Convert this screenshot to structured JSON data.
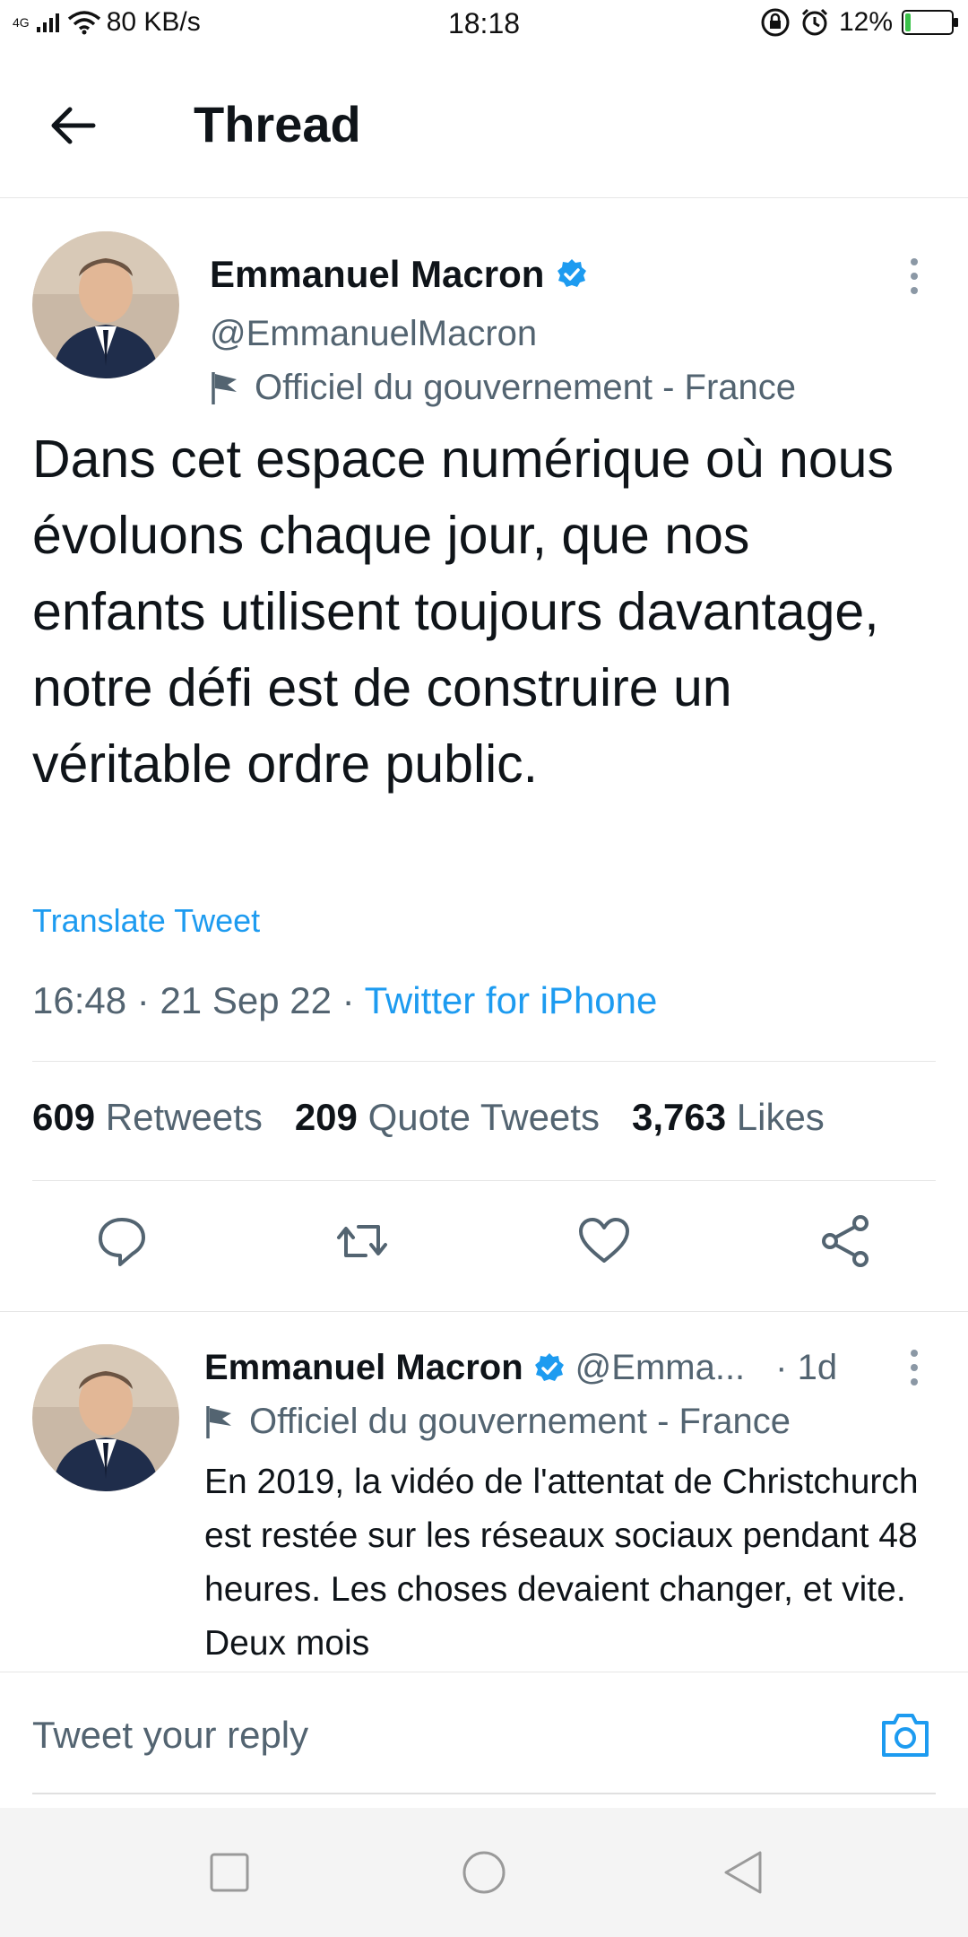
{
  "status_bar": {
    "network": "4G",
    "speed": "80 KB/s",
    "time": "18:18",
    "battery": "12%",
    "battery_level": 0.12
  },
  "header": {
    "title": "Thread"
  },
  "main_tweet": {
    "author_name": "Emmanuel Macron",
    "handle": "@EmmanuelMacron",
    "label": "Officiel du gouvernement - France",
    "text": "Dans cet espace numérique où nous évoluons chaque jour, que nos enfants utilisent toujours davantage, notre défi est de construire un véritable ordre public.",
    "translate": "Translate Tweet",
    "time": "16:48",
    "date": "21 Sep 22",
    "separator": "·",
    "source": "Twitter for iPhone",
    "retweets_count": "609",
    "retweets_label": "Retweets",
    "quotes_count": "209",
    "quotes_label": "Quote Tweets",
    "likes_count": "3,763",
    "likes_label": "Likes"
  },
  "reply_tweet": {
    "author_name": "Emmanuel Macron",
    "handle": "@Emma...",
    "age": "· 1d",
    "label": "Officiel du gouvernement - France",
    "text": "En 2019, la vidéo de l'attentat de Christchurch est restée sur les réseaux sociaux pendant 48 heures. Les choses devaient changer, et vite. Deux mois"
  },
  "composer": {
    "placeholder": "Tweet your reply"
  },
  "icons": {
    "back": "arrow-left-icon",
    "verified": "verified-badge-icon",
    "more": "more-vertical-icon",
    "flag": "flag-icon",
    "reply": "reply-icon",
    "retweet": "retweet-icon",
    "like": "heart-icon",
    "share": "share-icon",
    "camera": "camera-icon"
  },
  "colors": {
    "accent": "#1d9bf0",
    "text": "#0f1419",
    "secondary": "#536471"
  }
}
